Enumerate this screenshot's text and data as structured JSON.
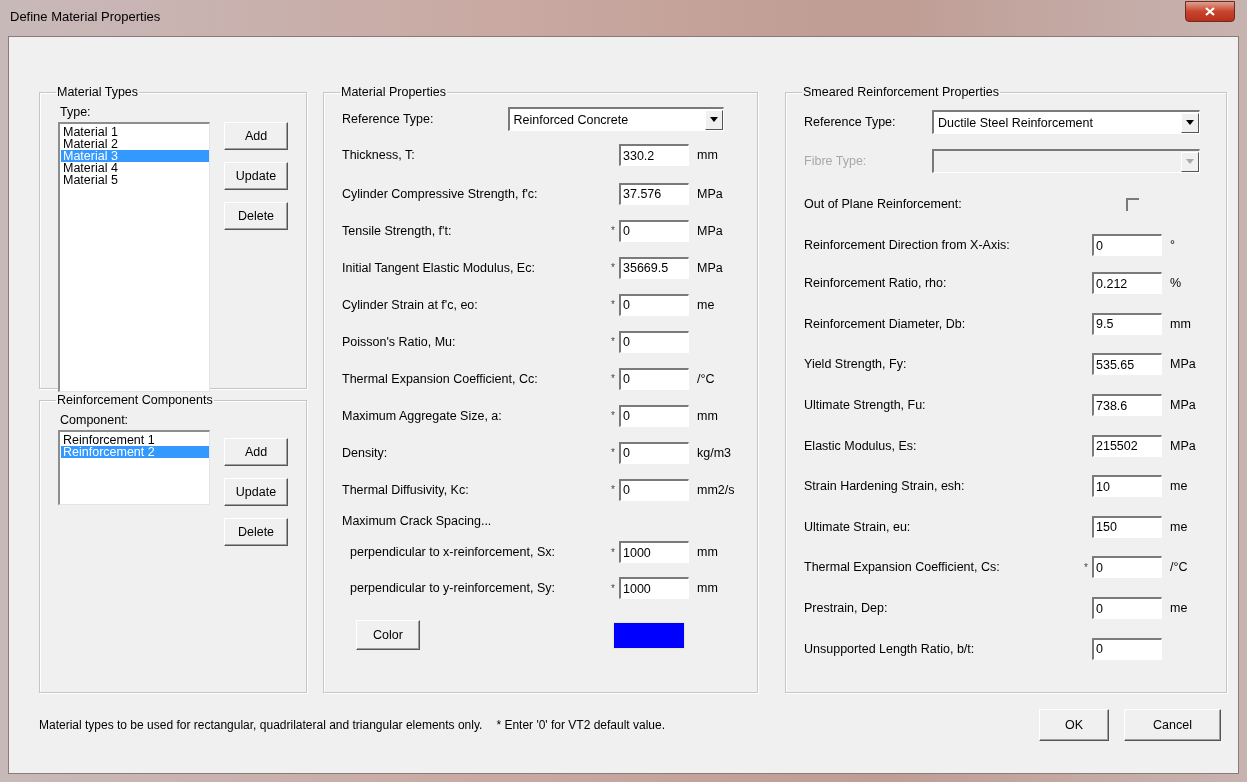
{
  "window": {
    "title": "Define Material Properties"
  },
  "material_types": {
    "title": "Material Types",
    "list_label": "Type:",
    "items": [
      {
        "label": "Material 1",
        "selected": false
      },
      {
        "label": "Material 2",
        "selected": false
      },
      {
        "label": "Material 3",
        "selected": true
      },
      {
        "label": "Material 4",
        "selected": false
      },
      {
        "label": "Material 5",
        "selected": false
      }
    ],
    "buttons": [
      "Add",
      "Update",
      "Delete"
    ]
  },
  "reinforcement_components": {
    "title": "Reinforcement Components",
    "list_label": "Component:",
    "items": [
      {
        "label": "Reinforcement 1",
        "selected": false
      },
      {
        "label": "Reinforcement 2",
        "selected": true
      }
    ],
    "buttons": [
      "Add",
      "Update",
      "Delete"
    ]
  },
  "material_properties": {
    "title": "Material Properties",
    "reference_type": {
      "label": "Reference Type:",
      "value": "Reinforced Concrete"
    },
    "fields": [
      {
        "label": "Thickness, T:",
        "value": "330.2",
        "unit": "mm"
      },
      {
        "label": "Cylinder Compressive Strength, f'c:",
        "value": "37.576",
        "unit": "MPa"
      },
      {
        "label": "Tensile Strength, f't:",
        "note": "*",
        "value": "0",
        "unit": "MPa"
      },
      {
        "label": "Initial Tangent Elastic Modulus, Ec:",
        "note": "*",
        "value": "35669.5",
        "unit": "MPa"
      },
      {
        "label": "Cylinder Strain at f'c, eo:",
        "note": "*",
        "value": "0",
        "unit": "me"
      },
      {
        "label": "Poisson's Ratio, Mu:",
        "note": "*",
        "value": "0"
      },
      {
        "label": "Thermal Expansion Coefficient, Cc:",
        "note": "*",
        "value": "0",
        "unit": "/°C"
      },
      {
        "label": "Maximum Aggregate Size, a:",
        "note": "*",
        "value": "0",
        "unit": "mm"
      },
      {
        "label": "Density:",
        "note": "*",
        "value": "0",
        "unit": "kg/m3"
      },
      {
        "label": "Thermal Diffusivity, Kc:",
        "note": "*",
        "value": "0",
        "unit": "mm2/s"
      }
    ],
    "crack_spacing_heading": "Maximum Crack Spacing...",
    "crack_fields": [
      {
        "label": "perpendicular to x-reinforcement, Sx:",
        "note": "*",
        "value": "1000",
        "unit": "mm"
      },
      {
        "label": "perpendicular to y-reinforcement, Sy:",
        "note": "*",
        "value": "1000",
        "unit": "mm"
      }
    ],
    "color_button": "Color",
    "color_swatch": {
      "color": "#0000ff"
    }
  },
  "smeared_reinforcement": {
    "title": "Smeared Reinforcement Properties",
    "selects": [
      {
        "label": "Reference Type:",
        "value": "Ductile Steel Reinforcement",
        "disabled": false
      },
      {
        "label": "Fibre Type:",
        "disabled": true
      }
    ],
    "out_of_plane": {
      "label": "Out of Plane Reinforcement:",
      "checked": false
    },
    "fields": [
      {
        "label": "Reinforcement Direction from X-Axis:",
        "value": "0",
        "unit": "°"
      },
      {
        "label": "Reinforcement Ratio, rho:",
        "value": "0.212",
        "unit": "%"
      },
      {
        "label": "Reinforcement Diameter, Db:",
        "value": "9.5",
        "unit": "mm"
      },
      {
        "label": "Yield Strength, Fy:",
        "value": "535.65",
        "unit": "MPa"
      },
      {
        "label": "Ultimate Strength, Fu:",
        "value": "738.6",
        "unit": "MPa"
      },
      {
        "label": "Elastic Modulus, Es:",
        "value": "215502",
        "unit": "MPa"
      },
      {
        "label": "Strain Hardening Strain, esh:",
        "value": "10",
        "unit": "me"
      },
      {
        "label": "Ultimate Strain, eu:",
        "value": "150",
        "unit": "me"
      },
      {
        "label": "Thermal Expansion Coefficient, Cs:",
        "note": "*",
        "value": "0",
        "unit": "/°C"
      },
      {
        "label": "Prestrain, Dep:",
        "value": "0",
        "unit": "me"
      },
      {
        "label": "Unsupported Length Ratio, b/t:",
        "value": "0"
      }
    ]
  },
  "footer": {
    "note": "Material types to be used for rectangular, quadrilateral and triangular elements only.",
    "default_note": "* Enter '0' for VT2 default value.",
    "buttons": [
      "OK",
      "Cancel"
    ]
  }
}
